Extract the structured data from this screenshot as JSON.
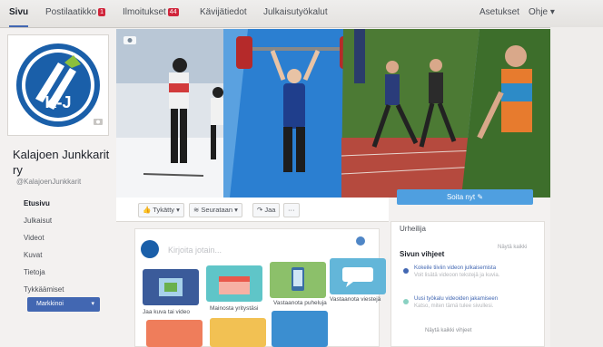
{
  "topbar": {
    "tabs": [
      {
        "label": "Sivu",
        "active": true
      },
      {
        "label": "Postilaatikko",
        "badge": "1"
      },
      {
        "label": "Ilmoitukset",
        "badge": "44"
      },
      {
        "label": "Kävijätiedot"
      },
      {
        "label": "Julkaisutyökalut"
      }
    ],
    "settings": "Asetukset",
    "help": "Ohje"
  },
  "page": {
    "name": "Kalajoen Junkkarit ry",
    "handle": "@KalajoenJunkkarit",
    "logo_text": "K-J"
  },
  "leftnav": {
    "items": [
      {
        "label": "Etusivu",
        "active": true
      },
      {
        "label": "Julkaisut"
      },
      {
        "label": "Videot"
      },
      {
        "label": "Kuvat"
      },
      {
        "label": "Tietoja"
      },
      {
        "label": "Tykkäämiset"
      }
    ],
    "promote": "Markkinoi"
  },
  "actions": {
    "like": "Tykätty",
    "follow": "Seurataan",
    "share": "Jaa",
    "more": "···",
    "send": "Soita nyt"
  },
  "composer": {
    "placeholder": "Kirjoita jotain...",
    "tiles": [
      {
        "label": "Jaa kuva tai video",
        "color": "#3b5b9a"
      },
      {
        "label": "Mainosta yritystäsi",
        "color": "#5fc5c8"
      },
      {
        "label": "Vastaanota puheluja",
        "color": "#8cc06a"
      },
      {
        "label": "Vastaanota viestejä",
        "color": "#63b6d9"
      }
    ]
  },
  "rightcol": {
    "category": "Urheilija",
    "tips_title": "Sivun vihjeet",
    "see_all": "Näytä kaikki",
    "tips": [
      {
        "title": "Kokeile tiiviin videon julkaisemista",
        "sub": "Voit lisätä videoon tekstejä ja kuvia."
      },
      {
        "title": "Uusi työkalu videoiden jakamiseen",
        "sub": "Katso, miten tämä tulee sivullesi."
      }
    ],
    "see_more": "Näytä kaikki vihjeet"
  },
  "colors": {
    "brand": "#4267b2",
    "send_button": "#4f9fe0",
    "topbar": "#e9e7e4"
  }
}
